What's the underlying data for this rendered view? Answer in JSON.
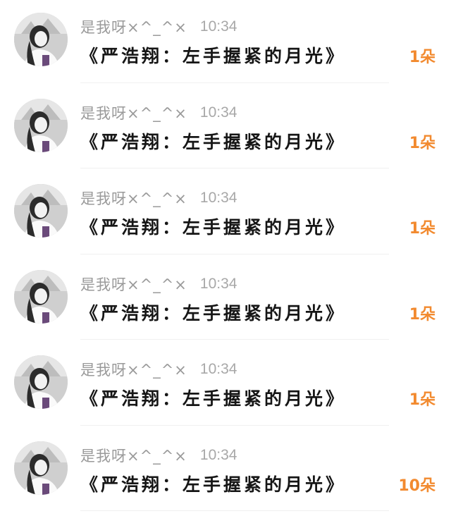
{
  "gift_list": {
    "items": [
      {
        "username": "是我呀×^_^×",
        "time": "10:34",
        "message": "《严浩翔：左手握紧的月光》",
        "count": "1朵",
        "avatar": "user-avatar"
      },
      {
        "username": "是我呀×^_^×",
        "time": "10:34",
        "message": "《严浩翔：左手握紧的月光》",
        "count": "1朵",
        "avatar": "user-avatar"
      },
      {
        "username": "是我呀×^_^×",
        "time": "10:34",
        "message": "《严浩翔：左手握紧的月光》",
        "count": "1朵",
        "avatar": "user-avatar"
      },
      {
        "username": "是我呀×^_^×",
        "time": "10:34",
        "message": "《严浩翔：左手握紧的月光》",
        "count": "1朵",
        "avatar": "user-avatar"
      },
      {
        "username": "是我呀×^_^×",
        "time": "10:34",
        "message": "《严浩翔：左手握紧的月光》",
        "count": "1朵",
        "avatar": "user-avatar"
      },
      {
        "username": "是我呀×^_^×",
        "time": "10:34",
        "message": "《严浩翔：左手握紧的月光》",
        "count": "10朵",
        "avatar": "user-avatar"
      }
    ],
    "colors": {
      "count": "#f28a2f",
      "username": "#9a9a9a",
      "message": "#161616"
    }
  }
}
